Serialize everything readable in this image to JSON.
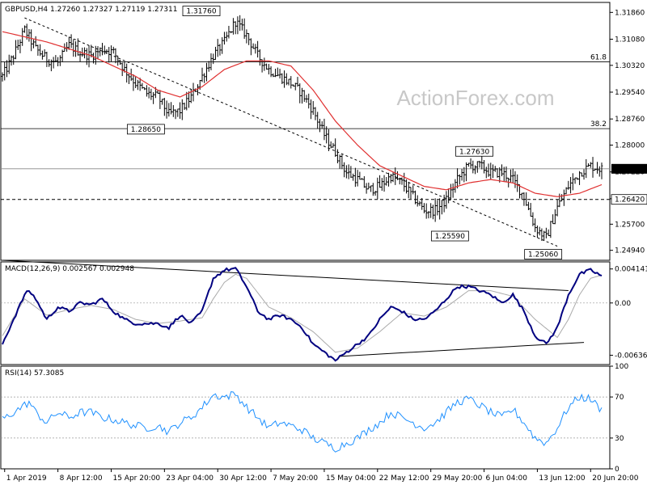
{
  "chart_data": [
    {
      "type": "candlestick",
      "title": "GBPUSD,H4  1.27260 1.27327 1.27119 1.27311",
      "watermark": "ActionForex.com",
      "ylim": [
        1.2465,
        1.3215
      ],
      "yticks": [
        "1.31860",
        "1.31080",
        "1.30320",
        "1.29540",
        "1.28760",
        "1.28000",
        "1.27220",
        "1.26440",
        "1.25700",
        "1.24940"
      ],
      "xticks": [
        "1 Apr 2019",
        "8 Apr 12:00",
        "15 Apr 20:00",
        "23 Apr 04:00",
        "30 Apr 12:00",
        "7 May 20:00",
        "15 May 04:00",
        "22 May 12:00",
        "29 May 20:00",
        "6 Jun 04:00",
        "13 Jun 12:00",
        "20 Jun 20:00"
      ],
      "current_price_label": "1.27311",
      "current_price": 1.27311,
      "support_label": "1.26420",
      "support_level": 1.2642,
      "fib_levels": [
        {
          "label": "61.8",
          "value": 1.3042
        },
        {
          "label": "38.2",
          "value": 1.2848
        }
      ],
      "annotations": [
        {
          "label": "1.31760",
          "value": 1.3176
        },
        {
          "label": "1.28650",
          "value": 1.2865
        },
        {
          "label": "1.27630",
          "value": 1.2763
        },
        {
          "label": "1.25590",
          "value": 1.2559
        },
        {
          "label": "1.25060",
          "value": 1.2506
        }
      ],
      "price_key_points": [
        [
          0,
          1.3
        ],
        [
          5,
          1.306
        ],
        [
          10,
          1.3135
        ],
        [
          15,
          1.308
        ],
        [
          20,
          1.305
        ],
        [
          25,
          1.304
        ],
        [
          30,
          1.309
        ],
        [
          35,
          1.307
        ],
        [
          40,
          1.306
        ],
        [
          45,
          1.308
        ],
        [
          50,
          1.307
        ],
        [
          55,
          1.302
        ],
        [
          60,
          1.298
        ],
        [
          65,
          1.295
        ],
        [
          70,
          1.294
        ],
        [
          75,
          1.289
        ],
        [
          80,
          1.29
        ],
        [
          85,
          1.294
        ],
        [
          90,
          1.3
        ],
        [
          95,
          1.306
        ],
        [
          100,
          1.31
        ],
        [
          105,
          1.316
        ],
        [
          110,
          1.312
        ],
        [
          115,
          1.306
        ],
        [
          120,
          1.302
        ],
        [
          125,
          1.3
        ],
        [
          130,
          1.298
        ],
        [
          135,
          1.295
        ],
        [
          140,
          1.29
        ],
        [
          145,
          1.283
        ],
        [
          150,
          1.278
        ],
        [
          155,
          1.272
        ],
        [
          160,
          1.27
        ],
        [
          165,
          1.267
        ],
        [
          170,
          1.268
        ],
        [
          175,
          1.271
        ],
        [
          180,
          1.269
        ],
        [
          185,
          1.265
        ],
        [
          190,
          1.261
        ],
        [
          195,
          1.261
        ],
        [
          200,
          1.264
        ],
        [
          205,
          1.27
        ],
        [
          210,
          1.274
        ],
        [
          215,
          1.274
        ],
        [
          220,
          1.272
        ],
        [
          225,
          1.272
        ],
        [
          230,
          1.27
        ],
        [
          235,
          1.265
        ],
        [
          240,
          1.256
        ],
        [
          245,
          1.253
        ],
        [
          250,
          1.262
        ],
        [
          255,
          1.268
        ],
        [
          260,
          1.272
        ],
        [
          265,
          1.274
        ],
        [
          270,
          1.273
        ]
      ],
      "sma_key_points": [
        [
          0,
          1.313
        ],
        [
          20,
          1.31
        ],
        [
          40,
          1.306
        ],
        [
          60,
          1.3
        ],
        [
          70,
          1.296
        ],
        [
          80,
          1.294
        ],
        [
          90,
          1.297
        ],
        [
          100,
          1.302
        ],
        [
          110,
          1.3045
        ],
        [
          120,
          1.3045
        ],
        [
          130,
          1.303
        ],
        [
          140,
          1.296
        ],
        [
          150,
          1.287
        ],
        [
          160,
          1.28
        ],
        [
          170,
          1.274
        ],
        [
          180,
          1.271
        ],
        [
          190,
          1.268
        ],
        [
          200,
          1.267
        ],
        [
          210,
          1.269
        ],
        [
          220,
          1.27
        ],
        [
          230,
          1.269
        ],
        [
          240,
          1.266
        ],
        [
          250,
          1.265
        ],
        [
          260,
          1.266
        ],
        [
          270,
          1.2685
        ]
      ],
      "trendline_key_points": [
        [
          10,
          1.317
        ],
        [
          250,
          1.2506
        ]
      ]
    },
    {
      "type": "line",
      "title": "MACD(12,26,9) 0.002567 0.002948",
      "ylim": [
        -0.0075,
        0.005
      ],
      "yticks": [
        "0.004141",
        "0.00",
        "-0.006365"
      ],
      "macd_key_points": [
        [
          0,
          -0.005
        ],
        [
          5,
          -0.002
        ],
        [
          10,
          0.001
        ],
        [
          12,
          0.0015
        ],
        [
          15,
          0.0005
        ],
        [
          20,
          -0.002
        ],
        [
          25,
          -0.0005
        ],
        [
          30,
          -0.001
        ],
        [
          35,
          0.0
        ],
        [
          40,
          -0.0002
        ],
        [
          45,
          0.0005
        ],
        [
          50,
          -0.001
        ],
        [
          55,
          -0.002
        ],
        [
          60,
          -0.0025
        ],
        [
          65,
          -0.0025
        ],
        [
          70,
          -0.0025
        ],
        [
          75,
          -0.003
        ],
        [
          80,
          -0.0015
        ],
        [
          85,
          -0.0025
        ],
        [
          90,
          -0.001
        ],
        [
          95,
          0.003
        ],
        [
          100,
          0.004
        ],
        [
          105,
          0.0042
        ],
        [
          110,
          0.002
        ],
        [
          115,
          -0.001
        ],
        [
          120,
          -0.002
        ],
        [
          125,
          -0.0015
        ],
        [
          130,
          -0.002
        ],
        [
          135,
          -0.003
        ],
        [
          140,
          -0.005
        ],
        [
          145,
          -0.006
        ],
        [
          150,
          -0.007
        ],
        [
          155,
          -0.006
        ],
        [
          160,
          -0.005
        ],
        [
          165,
          -0.004
        ],
        [
          170,
          -0.002
        ],
        [
          175,
          -0.0005
        ],
        [
          180,
          -0.001
        ],
        [
          185,
          -0.002
        ],
        [
          190,
          -0.002
        ],
        [
          195,
          -0.001
        ],
        [
          200,
          0.0005
        ],
        [
          205,
          0.002
        ],
        [
          210,
          0.002
        ],
        [
          215,
          0.0015
        ],
        [
          220,
          0.001
        ],
        [
          225,
          0.0
        ],
        [
          230,
          0.001
        ],
        [
          235,
          -0.001
        ],
        [
          240,
          -0.004
        ],
        [
          245,
          -0.005
        ],
        [
          250,
          -0.003
        ],
        [
          255,
          0.001
        ],
        [
          260,
          0.0035
        ],
        [
          265,
          0.004
        ],
        [
          270,
          0.0033
        ]
      ],
      "signal_key_points": [
        [
          0,
          -0.004
        ],
        [
          10,
          0.0005
        ],
        [
          20,
          -0.0015
        ],
        [
          30,
          -0.0008
        ],
        [
          40,
          -0.0003
        ],
        [
          50,
          -0.0008
        ],
        [
          60,
          -0.002
        ],
        [
          70,
          -0.0025
        ],
        [
          80,
          -0.0022
        ],
        [
          90,
          -0.0018
        ],
        [
          95,
          0.0005
        ],
        [
          100,
          0.0025
        ],
        [
          105,
          0.0035
        ],
        [
          110,
          0.003
        ],
        [
          120,
          -0.0005
        ],
        [
          130,
          -0.0018
        ],
        [
          140,
          -0.0035
        ],
        [
          150,
          -0.006
        ],
        [
          160,
          -0.0055
        ],
        [
          170,
          -0.0035
        ],
        [
          180,
          -0.0012
        ],
        [
          190,
          -0.0016
        ],
        [
          200,
          -0.0005
        ],
        [
          210,
          0.0015
        ],
        [
          220,
          0.0015
        ],
        [
          230,
          0.0008
        ],
        [
          240,
          -0.002
        ],
        [
          250,
          -0.0042
        ],
        [
          255,
          -0.002
        ],
        [
          260,
          0.001
        ],
        [
          265,
          0.003
        ],
        [
          270,
          0.0034
        ]
      ],
      "trendlines": [
        [
          [
            0,
            0.0052
          ],
          [
            255,
            0.0015
          ]
        ],
        [
          [
            152,
            -0.0065
          ],
          [
            262,
            -0.0048
          ]
        ]
      ]
    },
    {
      "type": "line",
      "title": "RSI(14) 57.3085",
      "ylim": [
        0,
        100
      ],
      "yticks": [
        "100",
        "70",
        "30",
        "0"
      ],
      "levels": [
        70,
        30
      ],
      "rsi_key_points": [
        [
          0,
          48
        ],
        [
          5,
          55
        ],
        [
          10,
          62
        ],
        [
          12,
          65
        ],
        [
          15,
          55
        ],
        [
          20,
          45
        ],
        [
          25,
          55
        ],
        [
          30,
          50
        ],
        [
          35,
          55
        ],
        [
          40,
          55
        ],
        [
          45,
          50
        ],
        [
          50,
          48
        ],
        [
          55,
          45
        ],
        [
          60,
          42
        ],
        [
          65,
          40
        ],
        [
          70,
          42
        ],
        [
          75,
          36
        ],
        [
          80,
          45
        ],
        [
          85,
          50
        ],
        [
          90,
          60
        ],
        [
          95,
          72
        ],
        [
          100,
          70
        ],
        [
          105,
          73
        ],
        [
          110,
          60
        ],
        [
          115,
          50
        ],
        [
          120,
          40
        ],
        [
          125,
          45
        ],
        [
          130,
          42
        ],
        [
          135,
          38
        ],
        [
          140,
          30
        ],
        [
          145,
          25
        ],
        [
          150,
          20
        ],
        [
          155,
          25
        ],
        [
          160,
          30
        ],
        [
          165,
          38
        ],
        [
          170,
          45
        ],
        [
          175,
          55
        ],
        [
          180,
          50
        ],
        [
          185,
          45
        ],
        [
          190,
          40
        ],
        [
          195,
          45
        ],
        [
          200,
          55
        ],
        [
          205,
          65
        ],
        [
          210,
          68
        ],
        [
          215,
          62
        ],
        [
          220,
          55
        ],
        [
          225,
          50
        ],
        [
          230,
          58
        ],
        [
          235,
          45
        ],
        [
          240,
          30
        ],
        [
          245,
          25
        ],
        [
          250,
          40
        ],
        [
          255,
          60
        ],
        [
          260,
          70
        ],
        [
          265,
          68
        ],
        [
          270,
          57
        ]
      ]
    }
  ]
}
